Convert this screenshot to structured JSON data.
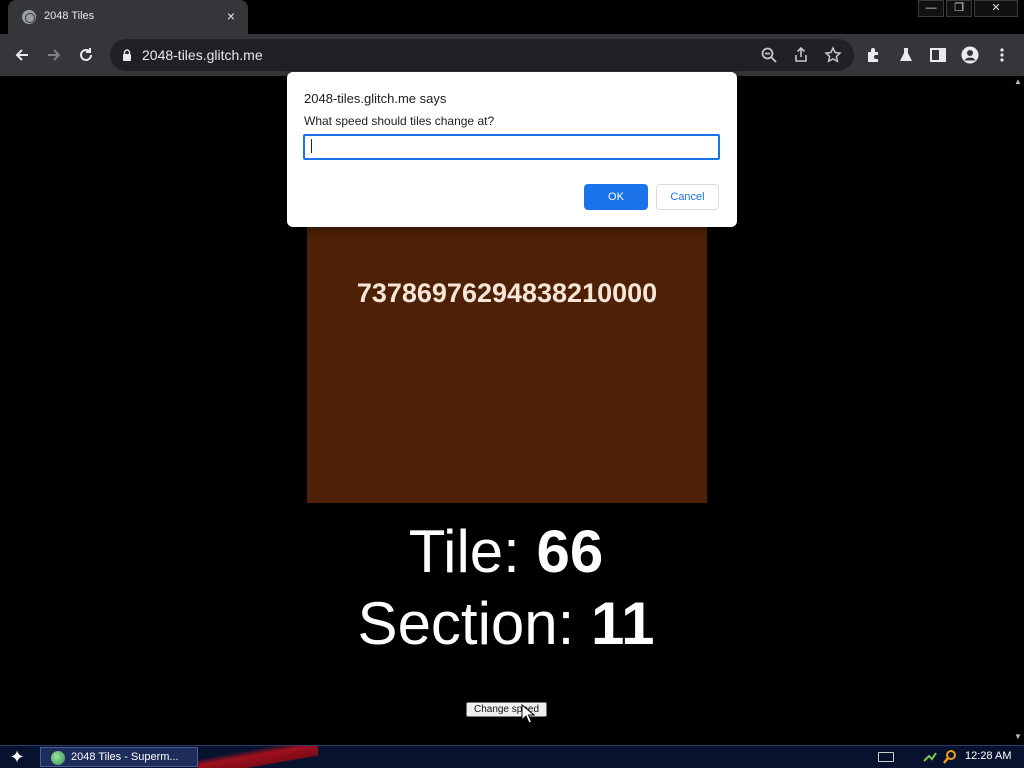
{
  "browser": {
    "tab_title": "2048 Tiles",
    "url": "2048-tiles.glitch.me"
  },
  "page": {
    "tile_value": "7378697629483821000 0",
    "tile_value_text": "73786976294838210000",
    "tile_label": "Tile: ",
    "tile_number": "66",
    "section_label": "Section: ",
    "section_number": "11",
    "change_speed_label": "Change speed",
    "tile_color": "#4e2106"
  },
  "dialog": {
    "origin": "2048-tiles.glitch.me says",
    "message": "What speed should tiles change at?",
    "input_value": "",
    "ok_label": "OK",
    "cancel_label": "Cancel"
  },
  "taskbar": {
    "task_label": "2048 Tiles - Superm...",
    "clock": "12:28 AM"
  },
  "icons": {
    "tab_close": "×",
    "minimize": "—",
    "restore": "❐",
    "close": "✕",
    "start": "✦"
  }
}
